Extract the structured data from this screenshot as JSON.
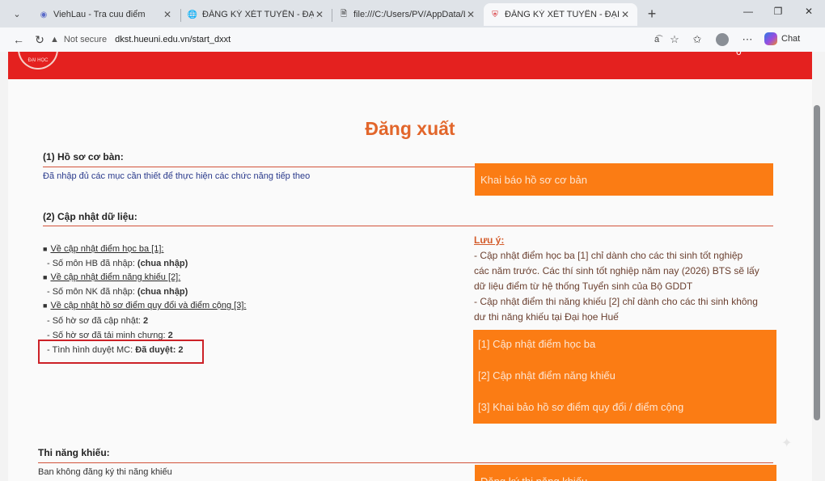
{
  "browser": {
    "tabs": [
      {
        "title": "ViehLau - Tra cuu điểm",
        "active": false
      },
      {
        "title": "ĐĂNG KÝ XÉT TUYỂN - ĐẠI HỌC H",
        "active": false
      },
      {
        "title": "file:///C:/Users/PV/AppData/Local",
        "active": false
      },
      {
        "title": "ĐĂNG KÝ XÉT TUYỂN - ĐẠI HỌC H",
        "active": true
      }
    ],
    "address": {
      "security": "Not secure",
      "url": "dkst.hueuni.edu.vn/start_dxxt"
    },
    "copilot_label": "Chat"
  },
  "header": {
    "counter": "0"
  },
  "page": {
    "title": "Đăng xuất",
    "section1": {
      "heading": "(1) Hồ sơ cơ bàn:",
      "status": "Đã nhập đủ các mục cần thiết để thực hiện các chức năng tiếp theo",
      "button": "Khai báo hồ sơ cơ bản"
    },
    "section2": {
      "heading": "(2) Cập nhật dữ liệu:",
      "items": [
        {
          "link": "Về cập nhật điểm học ba [1]:",
          "lines": [
            {
              "label": "- Số môn HB đã nhập: ",
              "value": "(chua nhập)"
            }
          ]
        },
        {
          "link": "Về cập nhật điểm năng khiếu [2]:",
          "lines": [
            {
              "label": "- Số môn NK đã nhập: ",
              "value": "(chua nhập)"
            }
          ]
        },
        {
          "link": "Về cập nhật hồ sơ điểm quy đổi và điểm cộng [3]:",
          "lines": [
            {
              "label": "- Số hờ sơ đã cập nhật: ",
              "value": "2"
            },
            {
              "label": "- Số hờ sơ đã tải minh chưng: ",
              "value": "2"
            },
            {
              "label": "- Tình hình duyệt MC: ",
              "value": "Đã duyệt: 2"
            }
          ]
        }
      ],
      "note": {
        "heading": "Lưu ý:",
        "lines": [
          "- Cập nhật điểm học ba [1] chỉ dành cho các thi sinh tốt nghiệp",
          "các năm trước. Các thí sinh tốt nghiệp năm nay (2026) BTS sẽ lấy",
          "dữ liệu điểm từ hệ thống Tuyển sinh của Bộ GDDT",
          "- Cập nhật điểm thi năng khiếu [2] chỉ dành cho các thi sinh không",
          "dư thi năng khiếu tại Đại họe Huế"
        ]
      },
      "actions": [
        "[1] Cập nhật điểm học ba",
        "[2] Cập nhật điểm năng khiếu",
        "[3] Khai bảo hồ sơ điểm quy đổi / điểm cộng"
      ]
    },
    "section3": {
      "heading": "Thi năng khiếu:",
      "status": "Ban không đăng ký thi năng khiếu",
      "button": "Đăng ký thi năng khiếu"
    }
  },
  "colors": {
    "header_red": "#e4211f",
    "accent_orange": "#fb7c14",
    "title_orange": "#e2662b",
    "highlight_box": "#cc2127"
  }
}
